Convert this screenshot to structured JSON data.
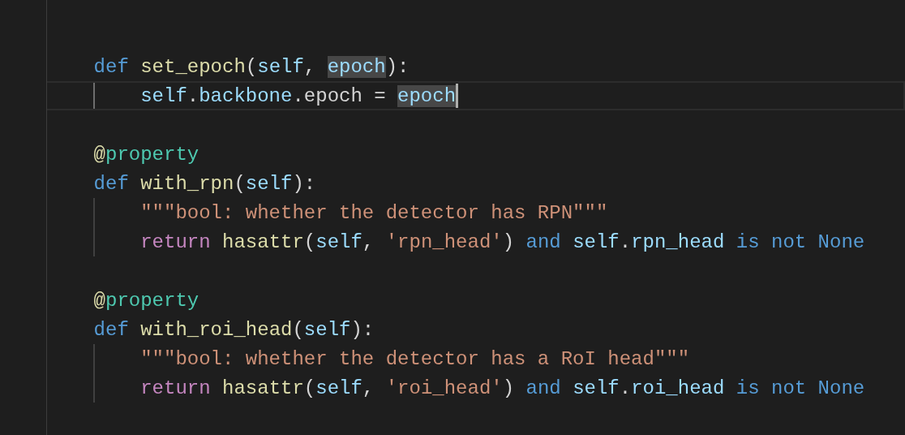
{
  "editor": {
    "lines": [
      {
        "current": false,
        "cursor": false
      },
      {
        "current": false,
        "cursor": false
      },
      {
        "current": false,
        "cursor": false,
        "tokens": [
          {
            "text": "def ",
            "kind": "keyword"
          },
          {
            "text": "set_epoch",
            "kind": "function"
          },
          {
            "text": "(",
            "kind": "plain"
          },
          {
            "text": "self",
            "kind": "variable"
          },
          {
            "text": ", ",
            "kind": "plain"
          },
          {
            "text": "epoch",
            "kind": "match"
          },
          {
            "text": "):",
            "kind": "plain"
          }
        ],
        "children": [
          {
            "current": true,
            "cursor": true,
            "tokens": [
              {
                "text": "self",
                "kind": "variable"
              },
              {
                "text": ".",
                "kind": "plain"
              },
              {
                "text": "backbone",
                "kind": "variable"
              },
              {
                "text": ".epoch = ",
                "kind": "plain"
              },
              {
                "text": "epoch",
                "kind": "match"
              }
            ]
          }
        ]
      },
      {
        "current": false,
        "cursor": false
      },
      {
        "current": false,
        "cursor": false,
        "tokens": [
          {
            "text": "@",
            "kind": "function"
          },
          {
            "text": "property",
            "kind": "class"
          }
        ]
      },
      {
        "current": false,
        "cursor": false,
        "tokens": [
          {
            "text": "def ",
            "kind": "keyword"
          },
          {
            "text": "with_rpn",
            "kind": "function"
          },
          {
            "text": "(",
            "kind": "plain"
          },
          {
            "text": "self",
            "kind": "variable"
          },
          {
            "text": "):",
            "kind": "plain"
          }
        ],
        "children": [
          {
            "current": false,
            "cursor": false,
            "tokens": [
              {
                "text": "\"\"\"bool: whether the detector has RPN\"\"\"",
                "kind": "string"
              }
            ]
          },
          {
            "current": false,
            "cursor": false,
            "tokens": [
              {
                "text": "return ",
                "kind": "control"
              },
              {
                "text": "hasattr",
                "kind": "function"
              },
              {
                "text": "(",
                "kind": "plain"
              },
              {
                "text": "self",
                "kind": "variable"
              },
              {
                "text": ", ",
                "kind": "plain"
              },
              {
                "text": "'rpn_head'",
                "kind": "string"
              },
              {
                "text": ") ",
                "kind": "plain"
              },
              {
                "text": "and ",
                "kind": "keyword"
              },
              {
                "text": "self",
                "kind": "variable"
              },
              {
                "text": ".",
                "kind": "plain"
              },
              {
                "text": "rpn_head ",
                "kind": "variable"
              },
              {
                "text": "is not None",
                "kind": "keyword"
              }
            ]
          }
        ]
      },
      {
        "current": false,
        "cursor": false
      },
      {
        "current": false,
        "cursor": false,
        "tokens": [
          {
            "text": "@",
            "kind": "function"
          },
          {
            "text": "property",
            "kind": "class"
          }
        ]
      },
      {
        "current": false,
        "cursor": false,
        "tokens": [
          {
            "text": "def ",
            "kind": "keyword"
          },
          {
            "text": "with_roi_head",
            "kind": "function"
          },
          {
            "text": "(",
            "kind": "plain"
          },
          {
            "text": "self",
            "kind": "variable"
          },
          {
            "text": "):",
            "kind": "plain"
          }
        ],
        "children": [
          {
            "current": false,
            "cursor": false,
            "tokens": [
              {
                "text": "\"\"\"bool: whether the detector has a RoI head\"\"\"",
                "kind": "string"
              }
            ]
          },
          {
            "current": false,
            "cursor": false,
            "tokens": [
              {
                "text": "return ",
                "kind": "control"
              },
              {
                "text": "hasattr",
                "kind": "function"
              },
              {
                "text": "(",
                "kind": "plain"
              },
              {
                "text": "self",
                "kind": "variable"
              },
              {
                "text": ", ",
                "kind": "plain"
              },
              {
                "text": "'roi_head'",
                "kind": "string"
              },
              {
                "text": ") ",
                "kind": "plain"
              },
              {
                "text": "and ",
                "kind": "keyword"
              },
              {
                "text": "self",
                "kind": "variable"
              },
              {
                "text": ".",
                "kind": "plain"
              },
              {
                "text": "roi_head ",
                "kind": "variable"
              },
              {
                "text": "is not None",
                "kind": "keyword"
              }
            ]
          }
        ]
      },
      {
        "current": false,
        "cursor": false
      }
    ]
  }
}
